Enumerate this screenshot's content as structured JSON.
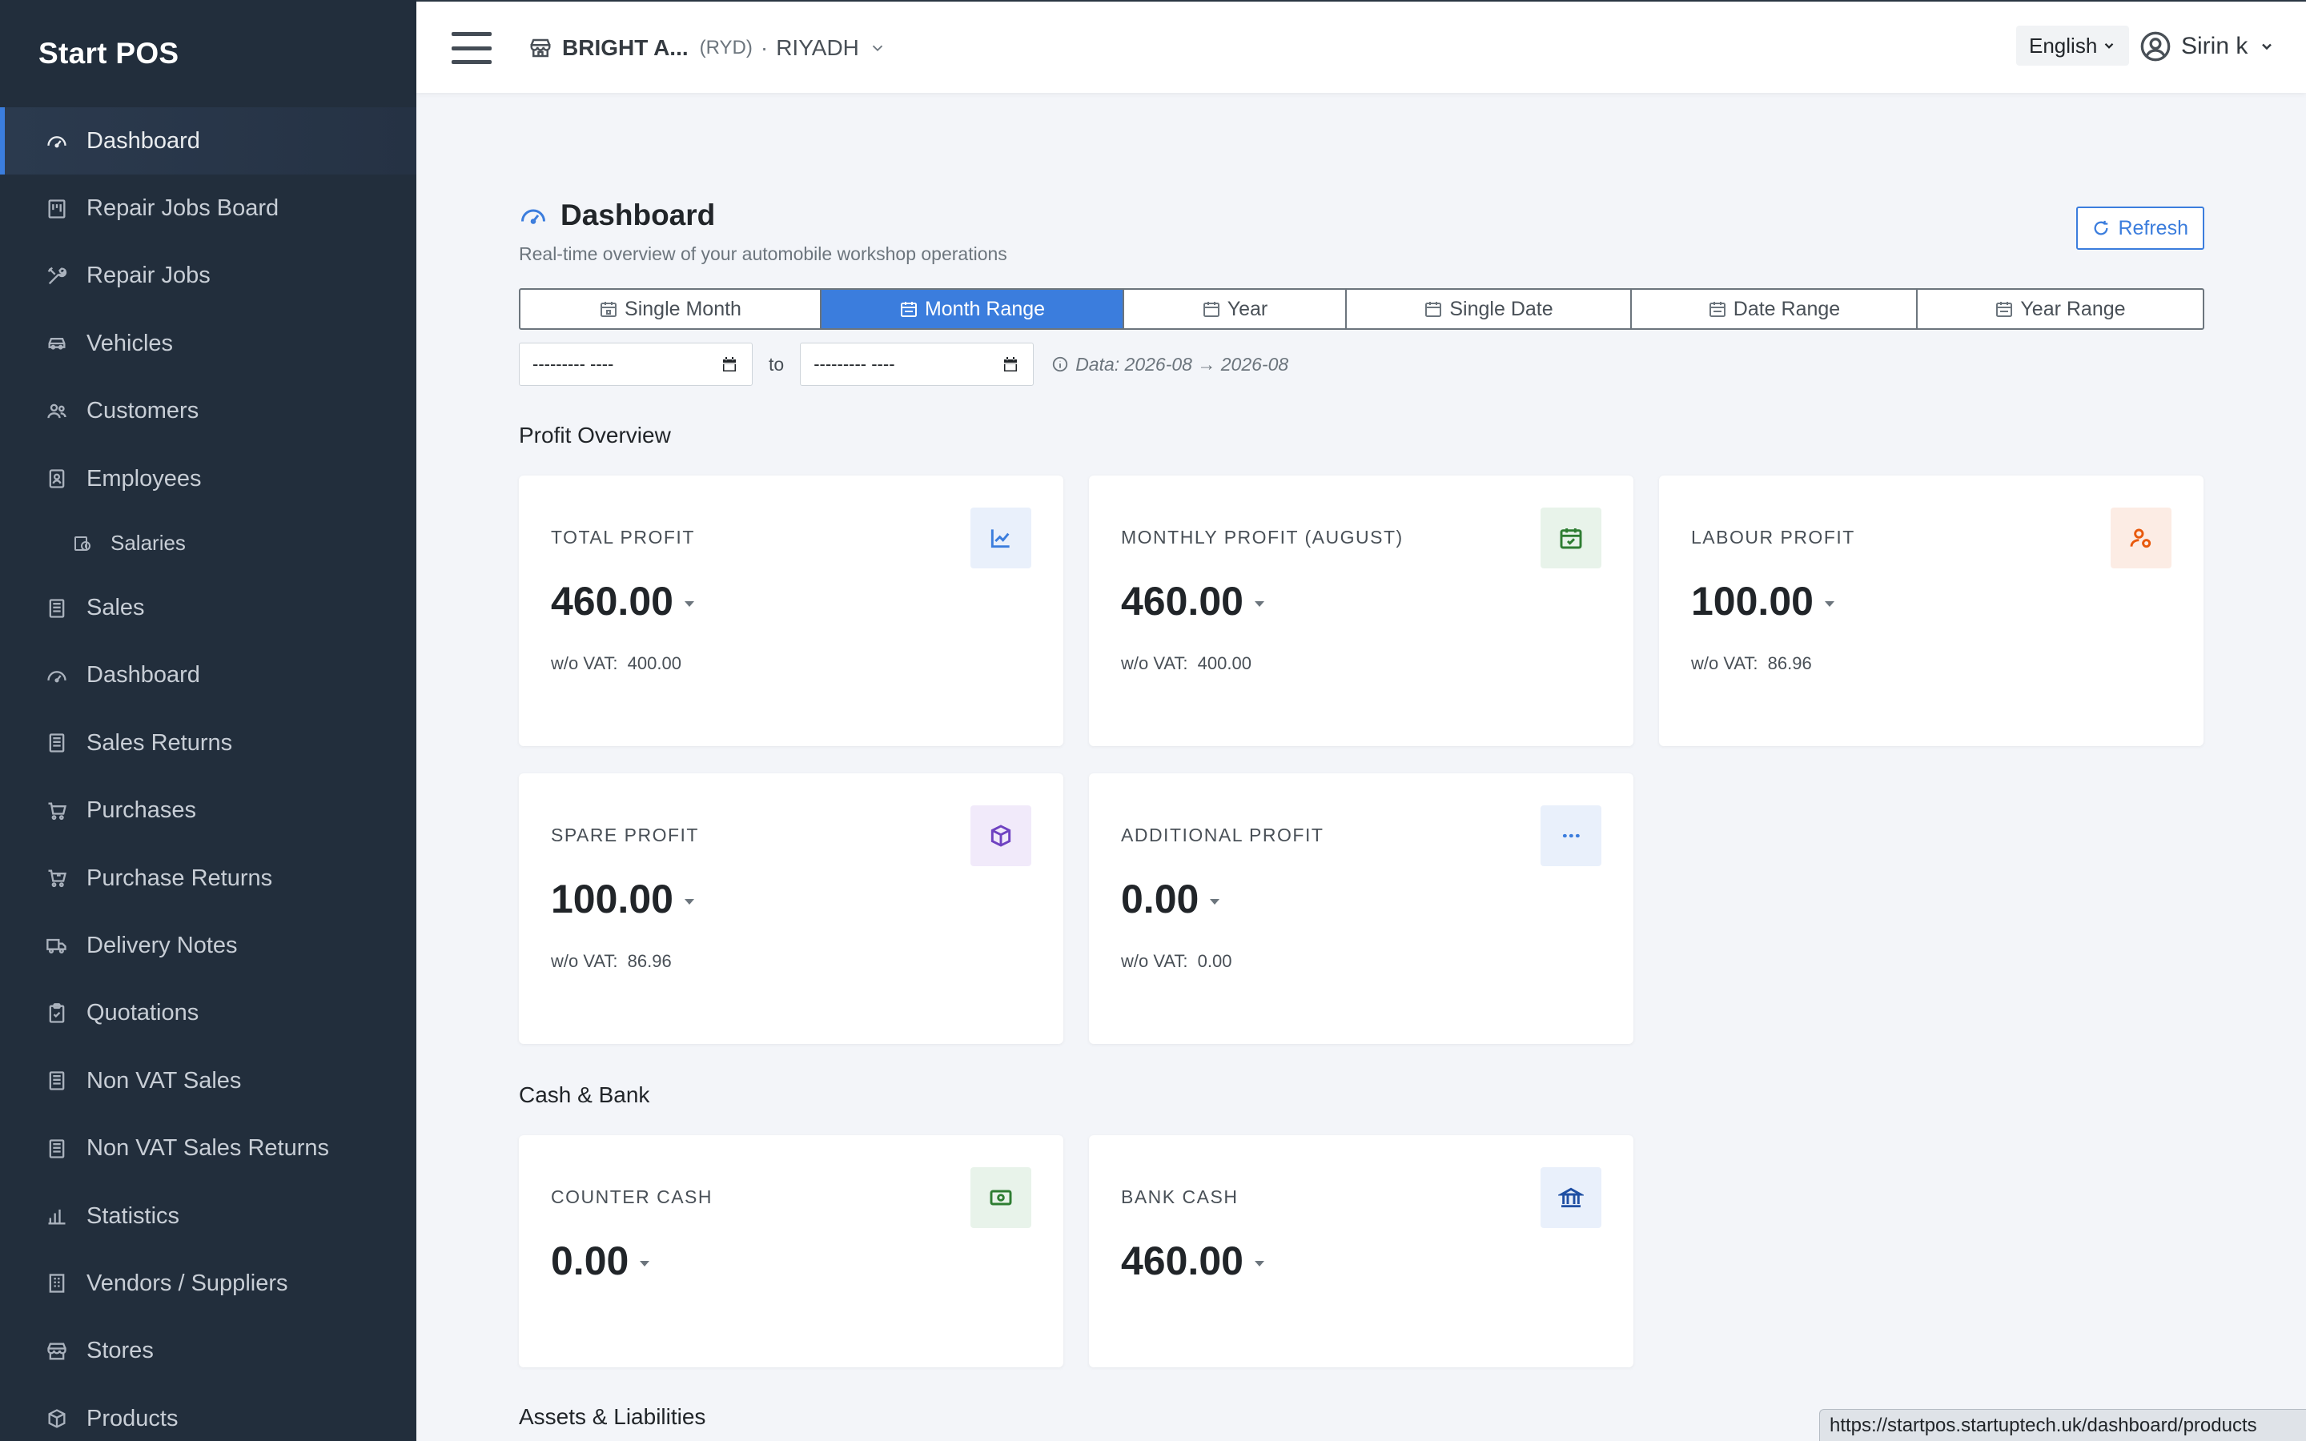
{
  "app": {
    "brand": "Start POS"
  },
  "sidebar": {
    "items": [
      {
        "label": "Dashboard",
        "icon": "gauge-icon",
        "active": true
      },
      {
        "label": "Repair Jobs Board",
        "icon": "board-icon"
      },
      {
        "label": "Repair Jobs",
        "icon": "tools-icon"
      },
      {
        "label": "Vehicles",
        "icon": "car-icon"
      },
      {
        "label": "Customers",
        "icon": "users-icon"
      },
      {
        "label": "Employees",
        "icon": "id-badge-icon"
      },
      {
        "label": "Salaries",
        "icon": "salary-icon",
        "sub": true
      },
      {
        "label": "Sales",
        "icon": "receipt-icon"
      },
      {
        "label": "Dashboard",
        "icon": "gauge-icon"
      },
      {
        "label": "Sales Returns",
        "icon": "receipt-icon"
      },
      {
        "label": "Purchases",
        "icon": "cart-icon"
      },
      {
        "label": "Purchase Returns",
        "icon": "cart-return-icon"
      },
      {
        "label": "Delivery Notes",
        "icon": "truck-icon"
      },
      {
        "label": "Quotations",
        "icon": "clipboard-icon"
      },
      {
        "label": "Non VAT Sales",
        "icon": "receipt-icon"
      },
      {
        "label": "Non VAT Sales Returns",
        "icon": "receipt-icon"
      },
      {
        "label": "Statistics",
        "icon": "bar-chart-icon"
      },
      {
        "label": "Vendors / Suppliers",
        "icon": "building-icon"
      },
      {
        "label": "Stores",
        "icon": "store-icon"
      },
      {
        "label": "Products",
        "icon": "box-icon"
      }
    ]
  },
  "topbar": {
    "store_name": "BRIGHT A...",
    "store_code": "(RYD)",
    "store_separator": "·",
    "store_city": "RIYADH",
    "language": "English",
    "user_name": "Sirin k"
  },
  "page": {
    "title": "Dashboard",
    "subtitle": "Real-time overview of your automobile workshop operations",
    "refresh_label": "Refresh"
  },
  "filters": {
    "tabs": [
      {
        "label": "Single Month",
        "icon": "calendar-day-icon"
      },
      {
        "label": "Month Range",
        "icon": "calendar-range-icon",
        "active": true
      },
      {
        "label": "Year",
        "icon": "calendar-grid-icon"
      },
      {
        "label": "Single Date",
        "icon": "calendar-icon"
      },
      {
        "label": "Date Range",
        "icon": "calendar-range-icon"
      },
      {
        "label": "Year Range",
        "icon": "calendar-range-icon"
      }
    ],
    "from_value": "--------- ----",
    "to_label": "to",
    "to_value": "--------- ----",
    "data_range": "Data: 2026-08 → 2026-08"
  },
  "sections": {
    "profit": "Profit Overview",
    "cash": "Cash & Bank",
    "assets": "Assets & Liabilities"
  },
  "cards": {
    "total_profit": {
      "label": "TOTAL PROFIT",
      "value": "460.00",
      "sub_key": "w/o VAT:",
      "sub_value": "400.00",
      "icon": "trend-chart-icon",
      "color": "#3b7ddd",
      "bg": "#e9f0fb"
    },
    "monthly_profit": {
      "label": "MONTHLY PROFIT (AUGUST)",
      "value": "460.00",
      "sub_key": "w/o VAT:",
      "sub_value": "400.00",
      "icon": "calendar-check-icon",
      "color": "#2e7d32",
      "bg": "#e8f3ea"
    },
    "labour_profit": {
      "label": "LABOUR PROFIT",
      "value": "100.00",
      "sub_key": "w/o VAT:",
      "sub_value": "86.96",
      "icon": "user-gear-icon",
      "color": "#e8590c",
      "bg": "#fcece4"
    },
    "spare_profit": {
      "label": "SPARE PROFIT",
      "value": "100.00",
      "sub_key": "w/o VAT:",
      "sub_value": "86.96",
      "icon": "cube-icon",
      "color": "#6f42c1",
      "bg": "#f1eafa"
    },
    "additional_profit": {
      "label": "ADDITIONAL PROFIT",
      "value": "0.00",
      "sub_key": "w/o VAT:",
      "sub_value": "0.00",
      "icon": "dots-icon",
      "color": "#3b7ddd",
      "bg": "#e9f0fb"
    },
    "counter_cash": {
      "label": "COUNTER CASH",
      "value": "0.00",
      "icon": "cash-icon",
      "color": "#2e7d32",
      "bg": "#e8f3ea"
    },
    "bank_cash": {
      "label": "BANK CASH",
      "value": "460.00",
      "icon": "bank-icon",
      "color": "#1f4fa3",
      "bg": "#e9f0fb"
    }
  },
  "status_bar": {
    "url": "https://startpos.startuptech.uk/dashboard/products"
  }
}
